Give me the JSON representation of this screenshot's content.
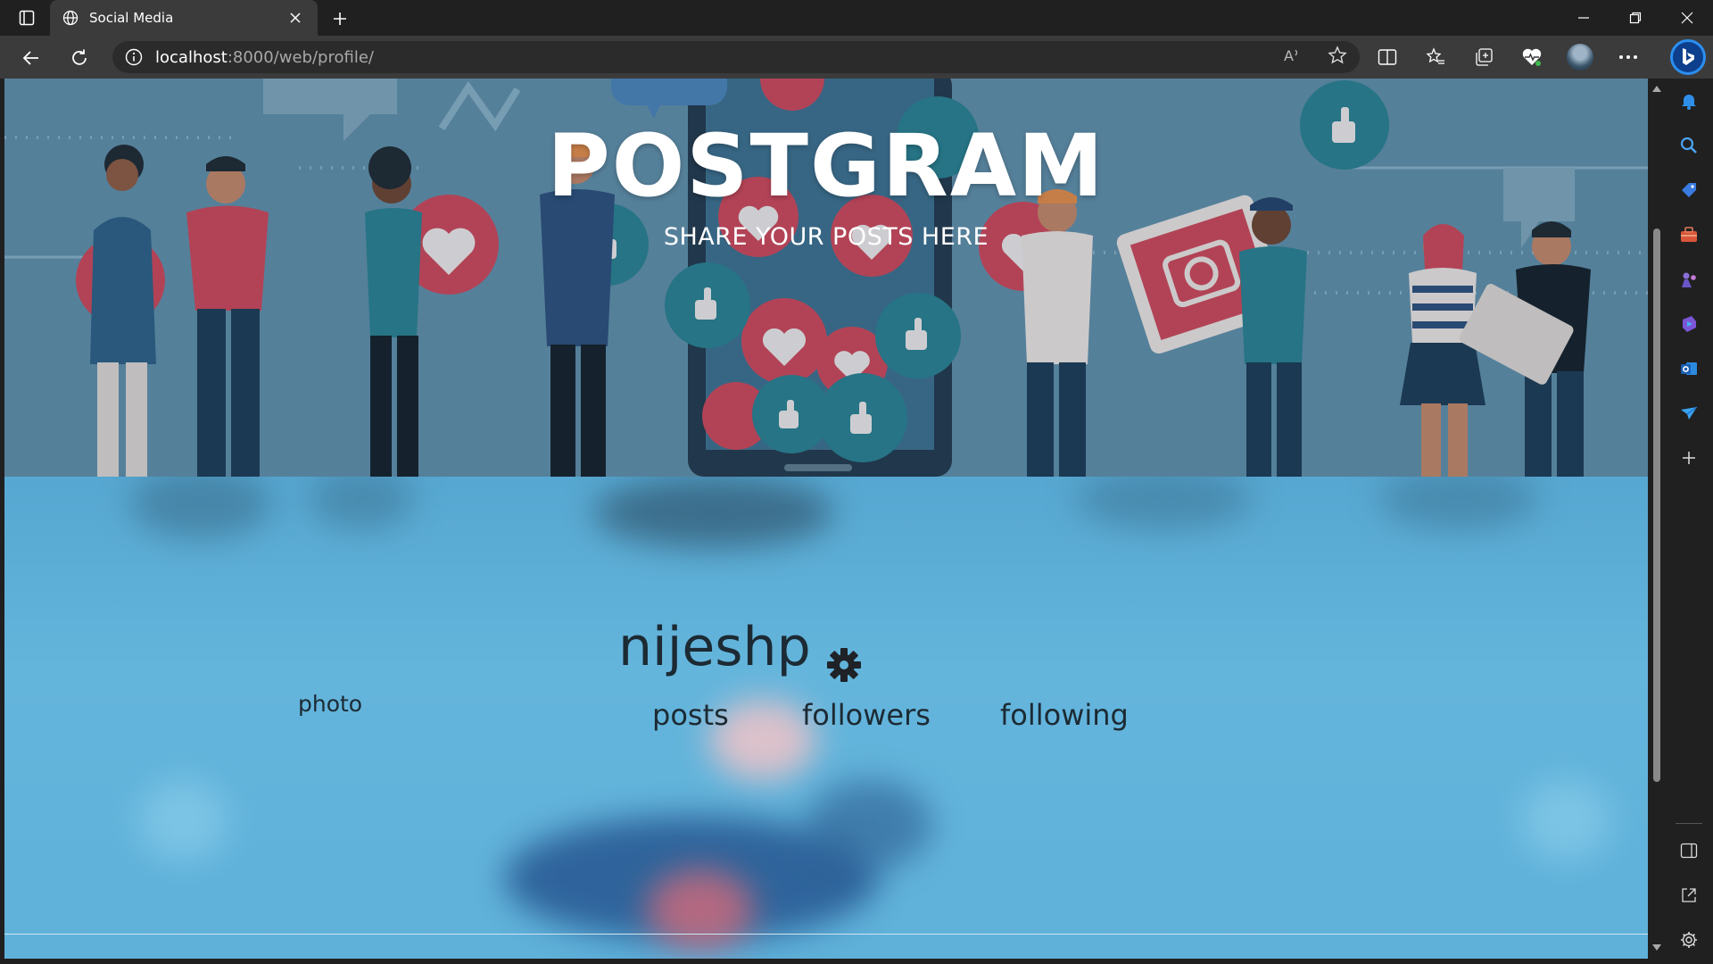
{
  "browser": {
    "tab_title": "Social Media",
    "url_host": "localhost",
    "url_rest": ":8000/web/profile/"
  },
  "page": {
    "brand": "POSTGRAM",
    "tagline": "SHARE YOUR POSTS HERE",
    "profile": {
      "username": "nijeshp",
      "photo_label": "photo",
      "stats": {
        "posts": "posts",
        "followers": "followers",
        "following": "following"
      }
    }
  },
  "icons": {
    "tab_actions": "tab-actions-icon",
    "globe": "globe-icon",
    "close": "close-icon",
    "new_tab": "plus-icon",
    "back": "back-arrow-icon",
    "refresh": "refresh-icon",
    "info": "info-icon",
    "read_aloud": "read-aloud-icon",
    "favorite": "star-icon",
    "split": "split-screen-icon",
    "favorites": "favorites-icon",
    "collections": "collections-icon",
    "health": "browser-essentials-icon",
    "more": "more-icon",
    "settings": "gear-icon"
  },
  "colors": {
    "chrome_dark": "#202020",
    "chrome_toolbar": "#3b3b3b",
    "hero_bg": "#5f8ca8",
    "profile_bg": "#5fb0d6",
    "text_dark": "#1c2a33",
    "heart_red": "#c9475a",
    "thumb_teal": "#2a7f90"
  }
}
